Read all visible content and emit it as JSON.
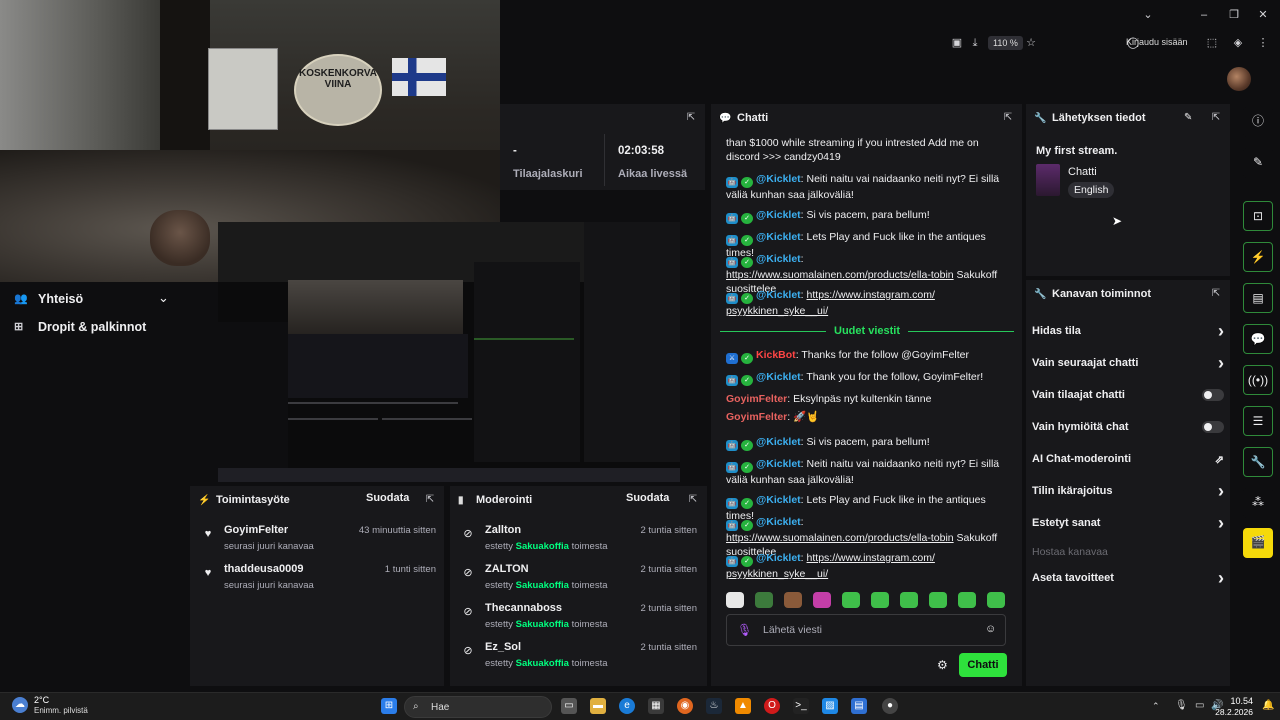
{
  "browser": {
    "zoom": "110 %",
    "signin_label": "Kirjaudu sisään"
  },
  "webcam": {
    "badge_text": "KOSKENKORVA VIINA"
  },
  "leftnav": {
    "items": [
      {
        "label": "Yhteisö",
        "icon": "people-icon"
      },
      {
        "label": "Dropit & palkinnot",
        "icon": "gift-icon"
      }
    ]
  },
  "stats": {
    "subs_value": "-",
    "subs_label": "Tilaajalaskuri",
    "uptime_value": "02:03:58",
    "uptime_label": "Aikaa livessä"
  },
  "activity": {
    "title": "Toimintasyöte",
    "filter_label": "Suodata",
    "rows": [
      {
        "user": "GoyimFelter",
        "event": "seurasi juuri kanavaa",
        "time": "43 minuuttia sitten"
      },
      {
        "user": "thaddeusa0009",
        "event": "seurasi juuri kanavaa",
        "time": "1 tunti sitten"
      }
    ]
  },
  "moderation": {
    "title": "Moderointi",
    "filter_label": "Suodata",
    "banned_prefix": "estetty",
    "by_user": "Sakuakoffia",
    "by_suffix": "toimesta",
    "rows": [
      {
        "user": "Zallton",
        "time": "2 tuntia sitten"
      },
      {
        "user": "ZALTON",
        "time": "2 tuntia sitten"
      },
      {
        "user": "Thecannaboss",
        "time": "2 tuntia sitten"
      },
      {
        "user": "Ez_Sol",
        "time": "2 tuntia sitten"
      }
    ]
  },
  "chat": {
    "title": "Chatti",
    "new_messages": "Uudet viestit",
    "input_placeholder": "Lähetä viesti",
    "send_label": "Chatti",
    "messages": [
      {
        "text": "than $1000 while streaming if you intrested Add me on discord >>> candzy0419"
      },
      {
        "user": "@Kicklet",
        "text": ": Neiti naitu vai naidaanko neiti nyt? Ei sillä väliä kunhan saa jälkoväliä!"
      },
      {
        "user": "@Kicklet",
        "text": ": Si vis pacem, para bellum!"
      },
      {
        "user": "@Kicklet",
        "text": ": Lets Play and Fuck like in the antiques times!"
      },
      {
        "user": "@Kicklet",
        "link": "https://www.suomalainen.com/products/ella-tobin",
        "text": " Sakukoff suosittelee"
      },
      {
        "user": "@Kicklet",
        "link": "https://www.instagram.com/ psyykkinen_syke__ui/"
      },
      {
        "user": "KickBot",
        "text": ": Thanks for the follow @GoyimFelter"
      },
      {
        "user": "@Kicklet",
        "text": ": Thank you for the follow, GoyimFelter!"
      },
      {
        "user": "GoyimFelter",
        "text": ": Eksylnpäs nyt kultenkin tänne"
      },
      {
        "user": "GoyimFelter",
        "text": ": 🚀🤘"
      },
      {
        "user": "@Kicklet",
        "text": ": Si vis pacem, para bellum!"
      },
      {
        "user": "@Kicklet",
        "text": ": Neiti naitu vai naidaanko neiti nyt? Ei sillä väliä kunhan saa jälkoväliä!"
      },
      {
        "user": "@Kicklet",
        "text": ": Lets Play and Fuck like in the antiques times!"
      },
      {
        "user": "@Kicklet",
        "link": "https://www.suomalainen.com/products/ella-tobin",
        "text": " Sakukoff suosittelee"
      },
      {
        "user": "@Kicklet",
        "link": "https://www.instagram.com/ psyykkinen_syke__ui/"
      }
    ]
  },
  "info": {
    "title": "Lähetyksen tiedot",
    "stream_title": "My first stream.",
    "category": "Chatti",
    "language": "English"
  },
  "actions": {
    "title": "Kanavan toiminnot",
    "items": [
      {
        "label": "Hidas tila",
        "control": "chevron"
      },
      {
        "label": "Vain seuraajat chatti",
        "control": "chevron"
      },
      {
        "label": "Vain tilaajat chatti",
        "control": "toggle"
      },
      {
        "label": "Vain hymiöitä chat",
        "control": "toggle"
      },
      {
        "label": "AI Chat-moderointi",
        "control": "external"
      },
      {
        "label": "Tilin ikärajoitus",
        "control": "chevron"
      },
      {
        "label": "Estetyt sanat",
        "control": "chevron"
      },
      {
        "label": "Hostaa kanavaa",
        "control": "disabled"
      },
      {
        "label": "Aseta tavoitteet",
        "control": "chevron"
      }
    ]
  },
  "taskbar": {
    "weather_temp": "2°C",
    "weather_desc": "Enimm. pilvistä",
    "search_label": "Hae",
    "time": "10.54",
    "date": "28.2.2026"
  },
  "colors": {
    "accent_green": "#53fc18",
    "panel_bg": "#18181b",
    "bg": "#0e0e10"
  }
}
